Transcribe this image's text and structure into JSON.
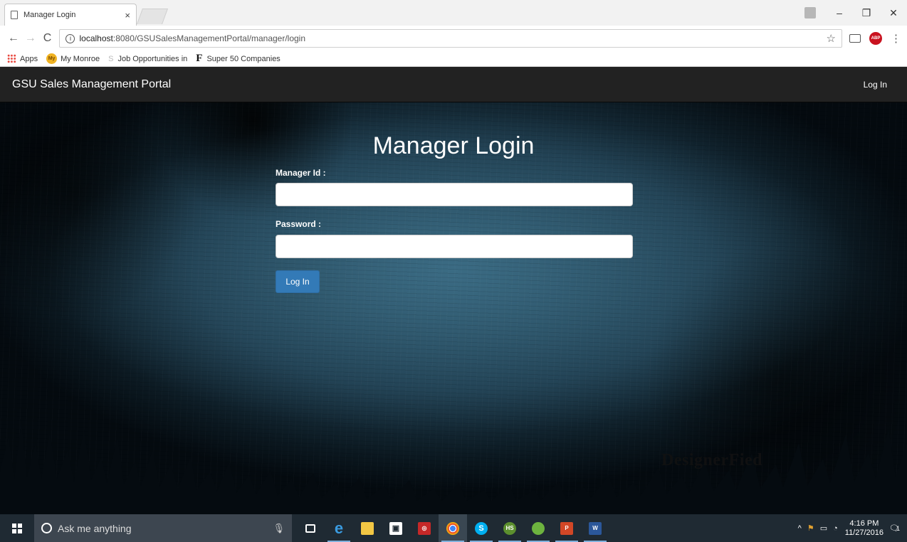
{
  "browser": {
    "tab_title": "Manager Login",
    "tab_close": "×",
    "url_host": "localhost",
    "url_rest": ":8080/GSUSalesManagementPortal/manager/login",
    "window_controls": [
      "–",
      "❐",
      "✕"
    ]
  },
  "bookmarks": {
    "apps": "Apps",
    "my_monroe": "My Monroe",
    "job_opps": "Job Opportunities in",
    "super50": "Super 50 Companies"
  },
  "navbar": {
    "brand": "GSU Sales Management Portal",
    "login_link": "Log In"
  },
  "login_form": {
    "title": "Manager Login",
    "manager_id_label": "Manager Id :",
    "manager_id_value": "",
    "password_label": "Password :",
    "password_value": "",
    "submit_label": "Log In"
  },
  "background": {
    "watermark": "DesignerFied"
  },
  "taskbar": {
    "search_placeholder": "Ask me anything",
    "time": "4:16 PM",
    "date": "11/27/2016",
    "notification_count": "1",
    "apps": [
      "task-view",
      "edge",
      "file-explorer",
      "store",
      "photo-app",
      "chrome",
      "skype",
      "hs-app",
      "spring-tool",
      "powerpoint",
      "word"
    ]
  },
  "colors": {
    "navbar_bg": "#222222",
    "primary_button": "#337ab7",
    "taskbar_bg": "#1f2a33"
  }
}
